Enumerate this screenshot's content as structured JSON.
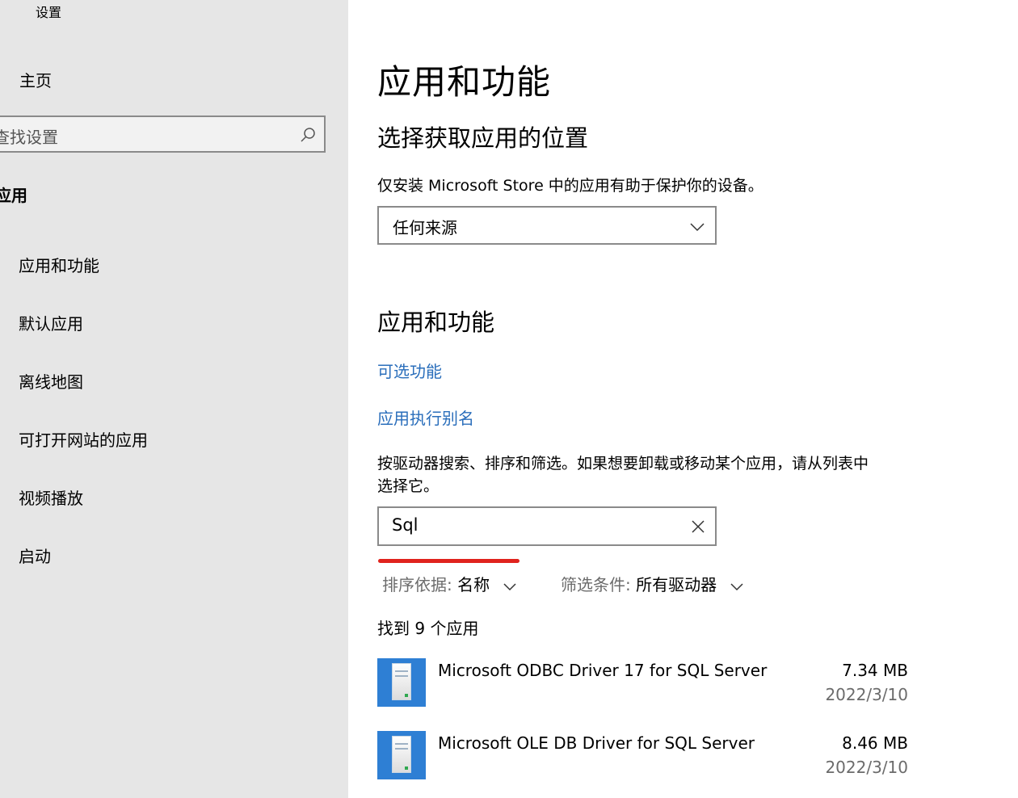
{
  "window": {
    "title": "设置"
  },
  "sidebar": {
    "home": "主页",
    "search_placeholder": "查找设置",
    "section": "应用",
    "items": [
      {
        "label": "应用和功能"
      },
      {
        "label": "默认应用"
      },
      {
        "label": "离线地图"
      },
      {
        "label": "可打开网站的应用"
      },
      {
        "label": "视频播放"
      },
      {
        "label": "启动"
      }
    ]
  },
  "main": {
    "title": "应用和功能",
    "choose_location": {
      "heading": "选择获取应用的位置",
      "description": "仅安装 Microsoft Store 中的应用有助于保护你的设备。",
      "dropdown_value": "任何来源"
    },
    "apps_features": {
      "heading": "应用和功能",
      "optional_features_link": "可选功能",
      "app_alias_link": "应用执行别名",
      "instructions_line1": "按驱动器搜索、排序和筛选。如果想要卸载或移动某个应用，请从列表中",
      "instructions_line2": "选择它。",
      "search_value": "Sql",
      "sort_label": "排序依据:",
      "sort_value": "名称",
      "filter_label": "筛选条件:",
      "filter_value": "所有驱动器",
      "found_text": "找到 9 个应用",
      "apps": [
        {
          "name": "Microsoft ODBC Driver 17 for SQL Server",
          "size": "7.34 MB",
          "date": "2022/3/10",
          "icon": "server-tower-icon"
        },
        {
          "name": "Microsoft OLE DB Driver for SQL Server",
          "size": "8.46 MB",
          "date": "2022/3/10",
          "icon": "server-tower-icon"
        }
      ]
    }
  },
  "colors": {
    "link": "#2a6ebb",
    "sidebar_bg": "#e6e6e6",
    "annotation": "#e0231d",
    "app_icon_bg": "#2e7fd4"
  }
}
